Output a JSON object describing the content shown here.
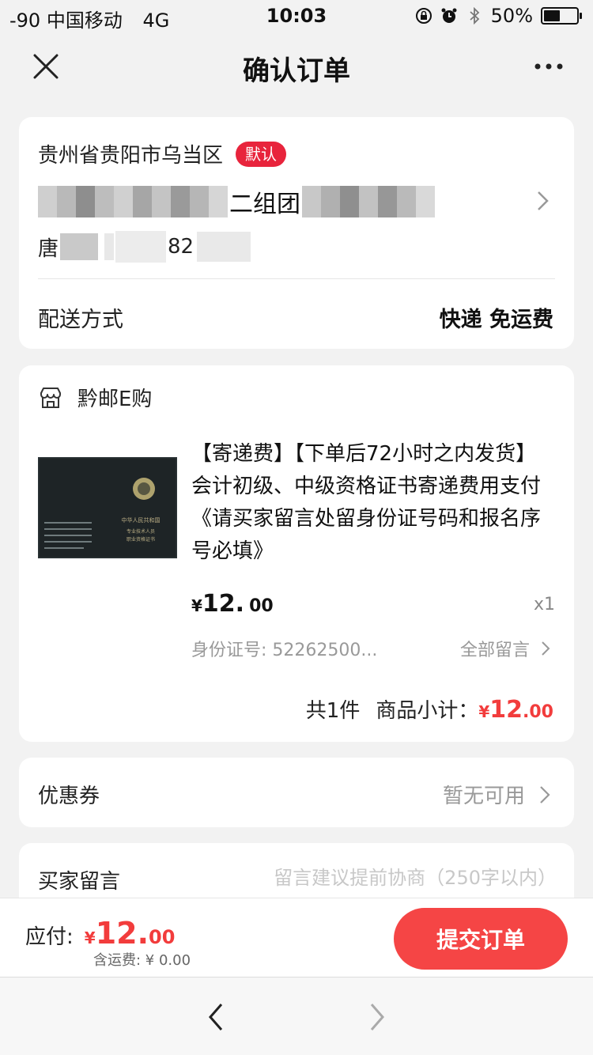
{
  "status_bar": {
    "carrier": "-90 中国移动",
    "network": "4G",
    "time": "10:03",
    "battery_percent": "50%",
    "battery_level": 0.5,
    "icons": [
      "rotation-lock-icon",
      "alarm-icon",
      "bluetooth-icon",
      "battery-icon"
    ]
  },
  "nav": {
    "title": "确认订单",
    "close_icon": "close-icon",
    "more_icon": "more-icon"
  },
  "address": {
    "region": "贵州省贵阳市乌当区",
    "default_badge": "默认",
    "detail_visible": "二组团",
    "name_prefix": "唐",
    "phone_fragment": "82"
  },
  "shipping": {
    "label": "配送方式",
    "value": "快递 免运费"
  },
  "shop": {
    "name": "黔邮E购",
    "icon": "store-icon"
  },
  "product": {
    "title": "【寄递费】【下单后72小时之内发货】会计初级、中级资格证书寄递费用支付《请买家留言处留身份证号码和报名序号必填》",
    "price_currency": "¥",
    "price_int": "12.",
    "price_dec": "00",
    "quantity": "x1",
    "memo_preview": "身份证号: 52262500...",
    "memo_all": "全部留言",
    "image_text": {
      "header": "中华人民共和国",
      "sub1": "专业技术人员",
      "sub2": "职业资格证书"
    }
  },
  "subtotal": {
    "count": "共1件",
    "label": "商品小计：",
    "currency": "¥",
    "amount_int": "12",
    "amount_dec": ".00"
  },
  "coupon": {
    "label": "优惠券",
    "value": "暂无可用"
  },
  "buyer_memo": {
    "label": "买家留言",
    "placeholder": "留言建议提前协商（250字以内）"
  },
  "submit": {
    "pay_label": "应付:",
    "currency": "¥",
    "amount_int": "12.",
    "amount_dec": "00",
    "shipping_fee": "含运费: ¥ 0.00",
    "button": "提交订单"
  },
  "colors": {
    "accent_red": "#f23c3c",
    "badge_red": "#e8243c",
    "button_red": "#f54545",
    "background": "#f2f2f2"
  }
}
